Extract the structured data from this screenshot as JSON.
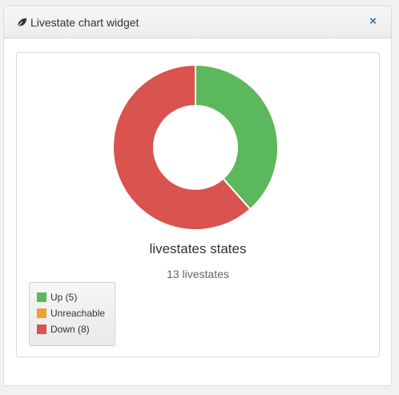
{
  "widget": {
    "title": "Livestate chart widget",
    "close_label": "×",
    "icon": "leaf-icon"
  },
  "chart_data": {
    "type": "pie",
    "title": "livestates states",
    "subtitle": "13 livestates",
    "legend_position": "bottom-left",
    "series": [
      {
        "name": "Up",
        "value": 5,
        "color": "#5cb85c",
        "legend": "Up (5)"
      },
      {
        "name": "Unreachable",
        "value": 0,
        "color": "#f0a030",
        "legend": "Unreachable"
      },
      {
        "name": "Down",
        "value": 8,
        "color": "#d9534f",
        "legend": "Down (8)"
      }
    ]
  }
}
